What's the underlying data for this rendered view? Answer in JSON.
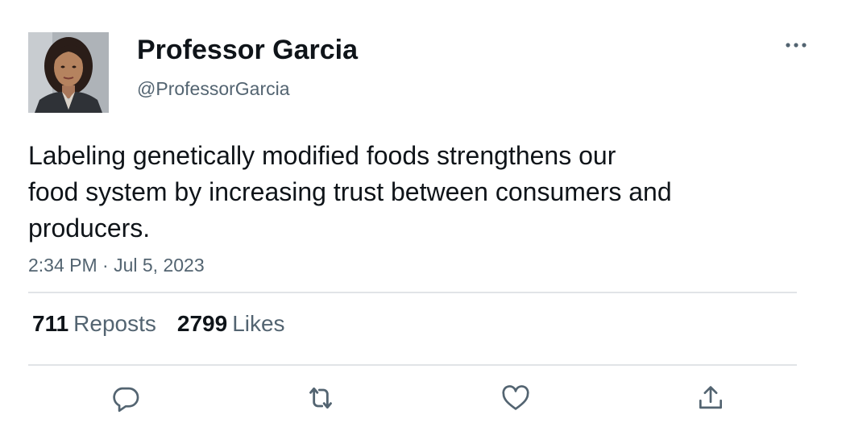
{
  "author": {
    "display_name": "Professor Garcia",
    "handle": "@ProfessorGarcia"
  },
  "tweet": {
    "text_lines": [
      "Labeling genetically modified foods strengthens our",
      "food system by increasing trust between consumers and",
      "producers."
    ],
    "timestamp": "2:34 PM · Jul 5, 2023"
  },
  "stats": {
    "reposts_count": "711",
    "reposts_label": "Reposts",
    "likes_count": "2799",
    "likes_label": "Likes"
  },
  "icons": {
    "more": "more-horizontal-icon",
    "reply": "reply-icon",
    "repost": "repost-icon",
    "like": "heart-icon",
    "share": "share-icon"
  },
  "colors": {
    "text_primary": "#0f1419",
    "text_secondary": "#536471",
    "divider": "#e1e4e7"
  }
}
